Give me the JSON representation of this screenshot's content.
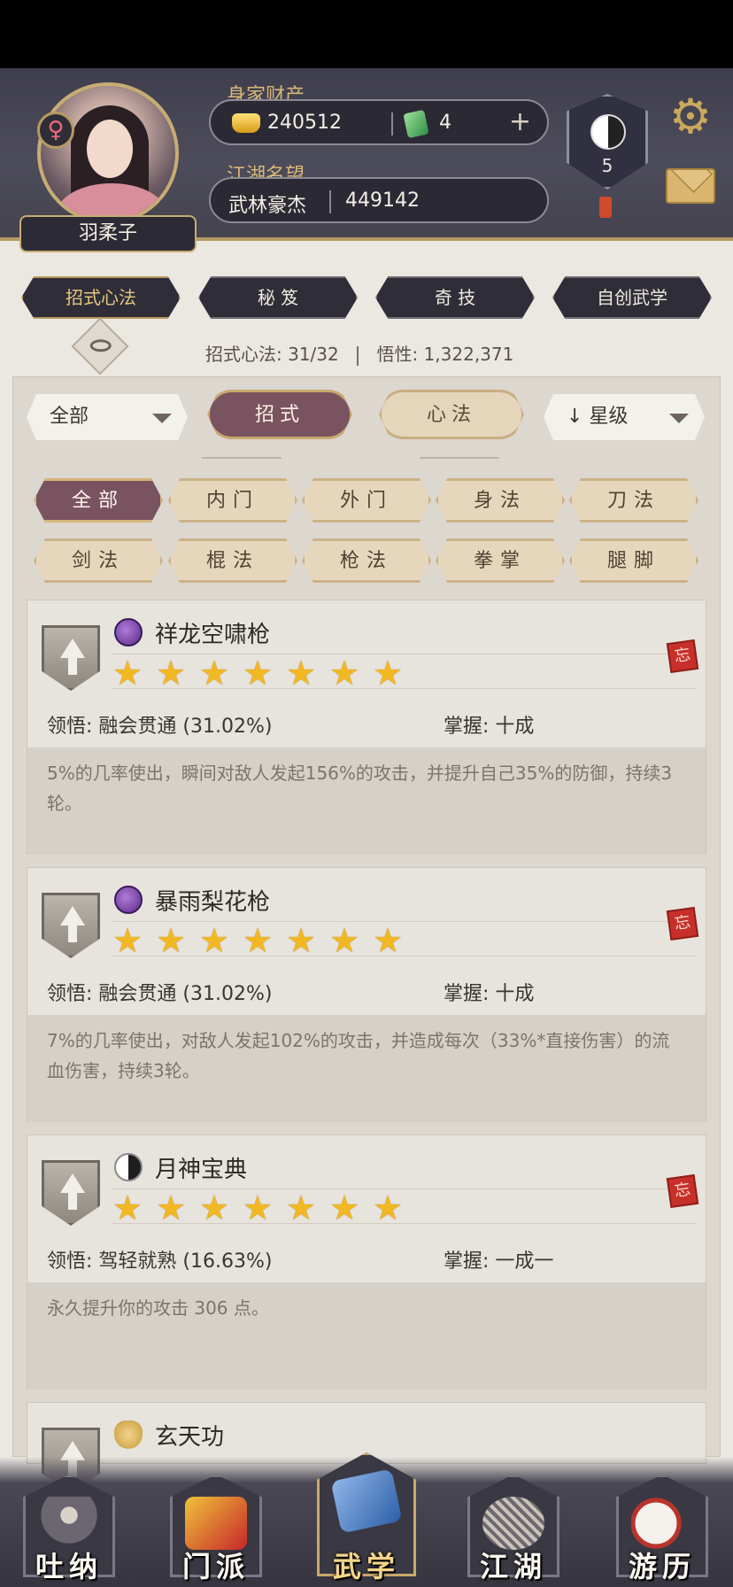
{
  "header": {
    "character_name": "羽柔子",
    "wealth_label": "身家财产",
    "gold_value": "240512",
    "jade_value": "4",
    "plus_symbol": "+",
    "fame_label": "江湖名望",
    "fame_title": "武林豪杰",
    "fame_value": "449142",
    "badge_level": "5",
    "gender_symbol": "♀"
  },
  "top_tabs": [
    {
      "label": "招式心法",
      "active": true
    },
    {
      "label": "秘 笈",
      "active": false
    },
    {
      "label": "奇 技",
      "active": false
    },
    {
      "label": "自创武学",
      "active": false
    }
  ],
  "stats": {
    "moves_label": "招式心法:",
    "moves_value": "31/32",
    "insight_label": "悟性:",
    "insight_value": "1,322,371"
  },
  "filters": {
    "scope_select": "全部",
    "seg_moves": "招式",
    "seg_mind": "心法",
    "sort_select": "星级",
    "sort_arrow": "↓"
  },
  "categories": [
    {
      "label": "全部",
      "active": true
    },
    {
      "label": "内门",
      "active": false
    },
    {
      "label": "外门",
      "active": false
    },
    {
      "label": "身法",
      "active": false
    },
    {
      "label": "刀法",
      "active": false
    },
    {
      "label": "剑法",
      "active": false
    },
    {
      "label": "棍法",
      "active": false
    },
    {
      "label": "枪法",
      "active": false
    },
    {
      "label": "拳掌",
      "active": false
    },
    {
      "label": "腿脚",
      "active": false
    }
  ],
  "skills": [
    {
      "name": "祥龙空啸枪",
      "type_icon": "purple-orb-icon",
      "stars": 7,
      "comprehension": "领悟: 融会贯通 (31.02%)",
      "mastery": "掌握: 十成",
      "description": "5%的几率使出，瞬间对敌人发起156%的攻击，并提升自己35%的防御，持续3轮。",
      "forget_label": "忘"
    },
    {
      "name": "暴雨梨花枪",
      "type_icon": "purple-orb-icon",
      "stars": 7,
      "comprehension": "领悟: 融会贯通 (31.02%)",
      "mastery": "掌握: 十成",
      "description": "7%的几率使出，对敌人发起102%的攻击，并造成每次（33%*直接伤害）的流血伤害，持续3轮。",
      "forget_label": "忘"
    },
    {
      "name": "月神宝典",
      "type_icon": "yin-yang-icon",
      "stars": 7,
      "comprehension": "领悟: 驾轻就熟 (16.63%)",
      "mastery": "掌握: 一成一",
      "description": "永久提升你的攻击 306 点。",
      "forget_label": "忘"
    },
    {
      "name": "玄天功",
      "type_icon": "gold-figure-icon"
    }
  ],
  "bottom_nav": [
    {
      "label": "吐纳",
      "active": false
    },
    {
      "label": "门派",
      "active": false
    },
    {
      "label": "武学",
      "active": true
    },
    {
      "label": "江湖",
      "active": false
    },
    {
      "label": "游历",
      "active": false
    }
  ],
  "colors": {
    "accent_gold": "#c8a86d",
    "active_tab_plum": "#7a5361",
    "star_gold": "#f2b823",
    "forget_red": "#c7302a"
  }
}
